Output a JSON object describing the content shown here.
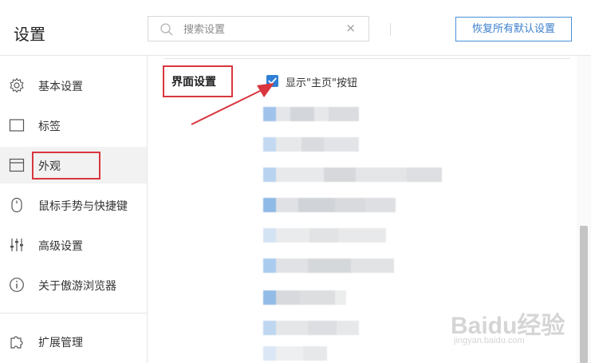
{
  "header": {
    "title": "设置",
    "search_placeholder": "搜索设置",
    "clear_symbol": "×",
    "reset_label": "恢复所有默认设置"
  },
  "sidebar": {
    "items": [
      {
        "label": "基本设置",
        "icon": "gear-icon"
      },
      {
        "label": "标签",
        "icon": "tab-icon"
      },
      {
        "label": "外观",
        "icon": "window-icon",
        "selected": true
      },
      {
        "label": "鼠标手势与快捷键",
        "icon": "mouse-icon"
      },
      {
        "label": "高级设置",
        "icon": "sliders-icon"
      },
      {
        "label": "关于傲游浏览器",
        "icon": "info-icon"
      }
    ],
    "extension": {
      "label": "扩展管理",
      "icon": "puzzle-icon"
    }
  },
  "main": {
    "section_title": "界面设置",
    "option": {
      "label": "显示\"主页\"按钮",
      "checked": true
    }
  },
  "watermark": {
    "brand": "Baidu经验",
    "url": "jingyan.baidu.com"
  },
  "colors": {
    "accent": "#2f7fd6",
    "highlight_box": "#d9363e",
    "active_bg": "#f2f2f2"
  }
}
